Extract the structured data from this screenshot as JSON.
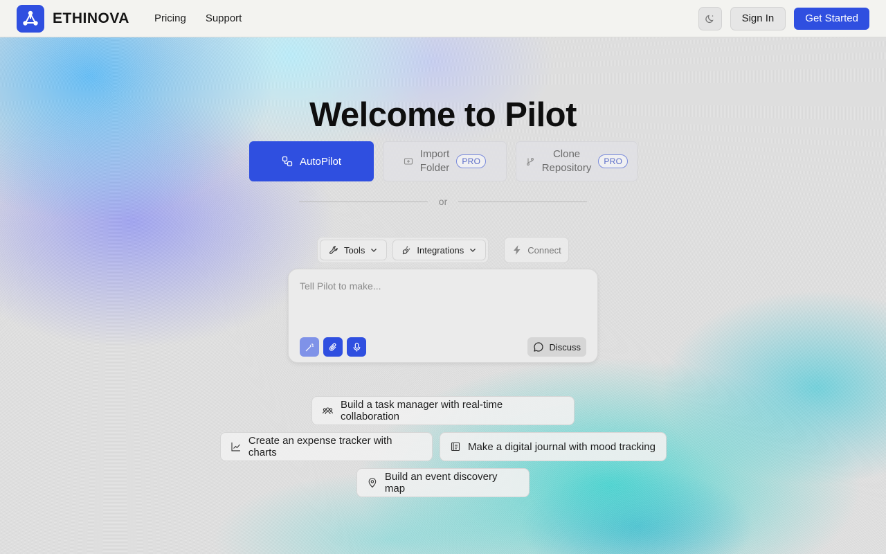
{
  "brand": {
    "name": "ETHINOVA",
    "logo_icon": "network-nodes-icon",
    "accent": "#2f4fe0"
  },
  "nav": {
    "pricing": "Pricing",
    "support": "Support"
  },
  "header": {
    "theme_icon": "moon-icon",
    "sign_in": "Sign In",
    "get_started": "Get Started"
  },
  "hero": {
    "title": "Welcome to Pilot"
  },
  "modes": {
    "autopilot": {
      "label": "AutoPilot",
      "icon": "autopilot-icon"
    },
    "import": {
      "line1": "Import",
      "line2": "Folder",
      "badge": "PRO",
      "icon": "folder-icon"
    },
    "clone": {
      "line1": "Clone",
      "line2": "Repository",
      "badge": "PRO",
      "icon": "git-branch-icon"
    }
  },
  "divider": {
    "text": "or"
  },
  "toolbar": {
    "tools": "Tools",
    "integrations": "Integrations",
    "connect": "Connect"
  },
  "prompt": {
    "placeholder": "Tell Pilot to make...",
    "value": "",
    "discuss": "Discuss"
  },
  "suggestions": [
    {
      "text": "Build a task manager with real-time collaboration",
      "icon": "users-icon"
    },
    {
      "text": "Create an expense tracker with charts",
      "icon": "line-chart-icon"
    },
    {
      "text": "Make a digital journal with mood tracking",
      "icon": "journal-icon"
    },
    {
      "text": "Build an event discovery map",
      "icon": "map-pin-icon"
    }
  ]
}
